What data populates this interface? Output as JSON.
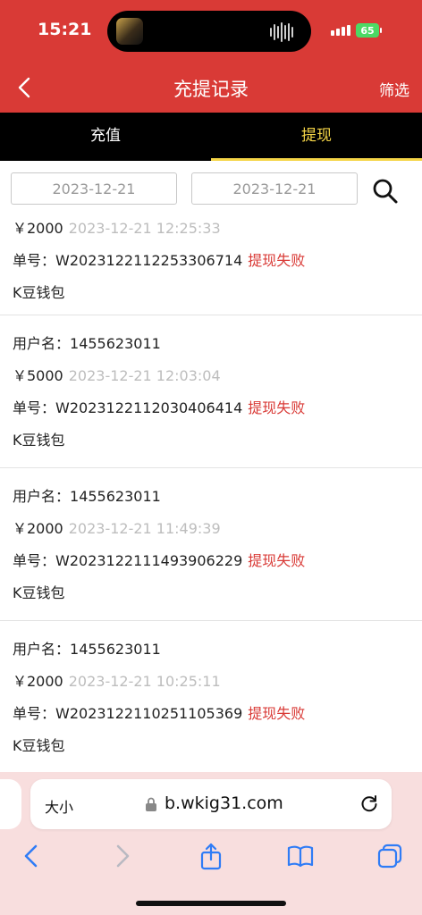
{
  "status_bar": {
    "time": "15:21",
    "battery": "65"
  },
  "header": {
    "title": "充提记录",
    "filter_label": "筛选"
  },
  "tabs": [
    {
      "label": "充值",
      "active": false
    },
    {
      "label": "提现",
      "active": true
    }
  ],
  "date_filter": {
    "start": "2023-12-21",
    "end": "2023-12-21"
  },
  "records": [
    {
      "amount": "￥2000",
      "time": "2023-12-21 12:25:33",
      "order_label": "单号：",
      "order_no": "W2023122112253306714",
      "status": "提现失败",
      "wallet": "K豆钱包"
    },
    {
      "user_label": "用户名：",
      "username": "1455623011",
      "amount": "￥5000",
      "time": "2023-12-21 12:03:04",
      "order_label": "单号：",
      "order_no": "W2023122112030406414",
      "status": "提现失败",
      "wallet": "K豆钱包"
    },
    {
      "user_label": "用户名：",
      "username": "1455623011",
      "amount": "￥2000",
      "time": "2023-12-21 11:49:39",
      "order_label": "单号：",
      "order_no": "W2023122111493906229",
      "status": "提现失败",
      "wallet": "K豆钱包"
    },
    {
      "user_label": "用户名：",
      "username": "1455623011",
      "amount": "￥2000",
      "time": "2023-12-21 10:25:11",
      "order_label": "单号：",
      "order_no": "W2023122110251105369",
      "status": "提现失败",
      "wallet": "K豆钱包"
    }
  ],
  "browser": {
    "text_size_label": "大小",
    "url": "b.wkig31.com"
  },
  "colors": {
    "brand_red": "#d93a36",
    "tab_active": "#f5d547",
    "status_fail": "#d93a36"
  }
}
